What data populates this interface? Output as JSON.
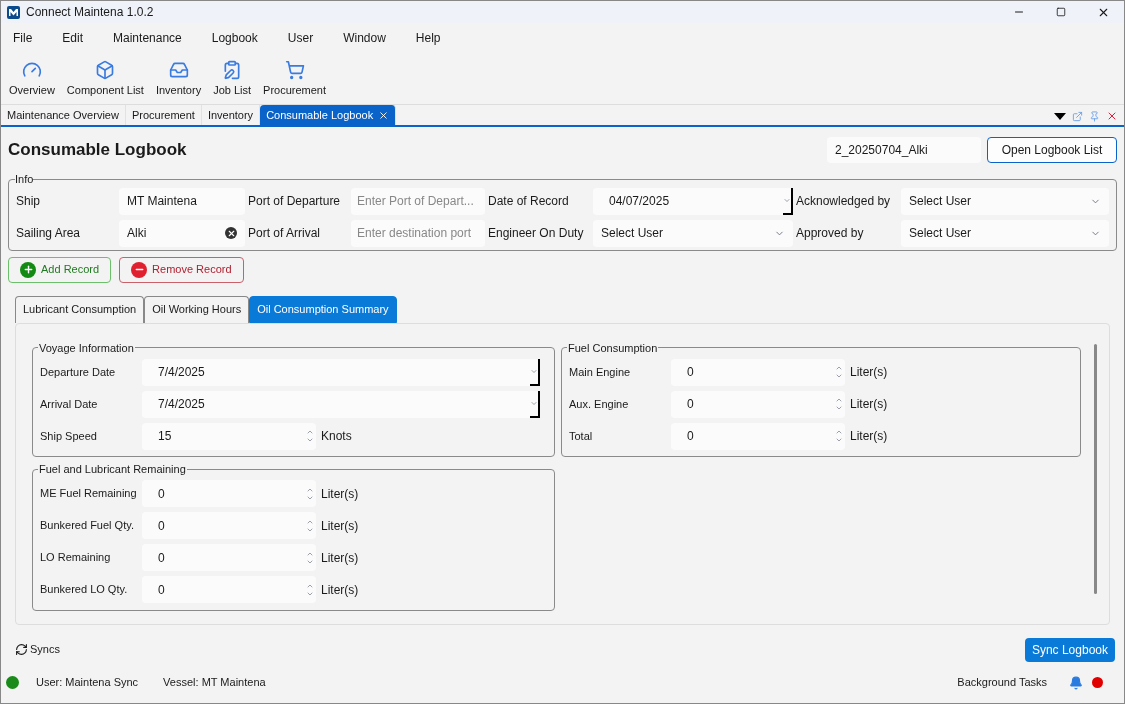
{
  "window": {
    "title": "Connect Maintena 1.0.2"
  },
  "menu": [
    "File",
    "Edit",
    "Maintenance",
    "Logbook",
    "User",
    "Window",
    "Help"
  ],
  "toolbar": [
    "Overview",
    "Component List",
    "Inventory",
    "Job List",
    "Procurement"
  ],
  "doc_tabs": [
    {
      "label": "Maintenance Overview",
      "selected": false,
      "closable": false
    },
    {
      "label": "Procurement",
      "selected": false,
      "closable": false
    },
    {
      "label": "Inventory",
      "selected": false,
      "closable": false
    },
    {
      "label": "Consumable Logbook",
      "selected": true,
      "closable": true
    }
  ],
  "header": {
    "title": "Consumable Logbook",
    "logbook_name": "2_20250704_Alki",
    "open_button": "Open Logbook List"
  },
  "info": {
    "legend": "Info",
    "fields": [
      {
        "label": "Ship",
        "kind": "text",
        "value": "MT Maintena"
      },
      {
        "label": "Port of Departure",
        "kind": "text",
        "placeholder": "Enter Port of Depart..."
      },
      {
        "label": "Date of Record",
        "kind": "date",
        "value": "04/07/2025"
      },
      {
        "label": "Acknowledged by",
        "kind": "select",
        "value": "Select User"
      },
      {
        "label": "Sailing Area",
        "kind": "clearable",
        "value": "Alki"
      },
      {
        "label": "Port of Arrival",
        "kind": "text",
        "placeholder": "Enter destination port"
      },
      {
        "label": "Engineer On Duty",
        "kind": "select",
        "value": "Select User"
      },
      {
        "label": "Approved by",
        "kind": "select",
        "value": "Select User"
      }
    ]
  },
  "actions": [
    {
      "label": "Add Record",
      "kind": "add"
    },
    {
      "label": "Remove Record",
      "kind": "remove"
    }
  ],
  "sub_tabs": [
    {
      "label": "Lubricant Consumption",
      "selected": false
    },
    {
      "label": "Oil Working Hours",
      "selected": false
    },
    {
      "label": "Oil Consumption Summary",
      "selected": true
    }
  ],
  "groups": [
    {
      "legend": "Voyage Information",
      "rows": [
        {
          "label": "Departure Date",
          "kind": "date",
          "value": "7/4/2025"
        },
        {
          "label": "Arrival Date",
          "kind": "date",
          "value": "7/4/2025"
        },
        {
          "label": "Ship Speed",
          "kind": "number",
          "value": "15",
          "unit": "Knots"
        }
      ]
    },
    {
      "legend": "Fuel Consumption",
      "rows": [
        {
          "label": "Main Engine",
          "kind": "number",
          "value": "0",
          "unit": "Liter(s)"
        },
        {
          "label": "Aux. Engine",
          "kind": "number",
          "value": "0",
          "unit": "Liter(s)"
        },
        {
          "label": "Total",
          "kind": "number",
          "value": "0",
          "unit": "Liter(s)"
        }
      ]
    },
    {
      "legend": "Fuel and Lubricant Remaining",
      "rows": [
        {
          "label": "ME Fuel Remaining",
          "kind": "number",
          "value": "0",
          "unit": "Liter(s)"
        },
        {
          "label": "Bunkered Fuel Qty.",
          "kind": "number",
          "value": "0",
          "unit": "Liter(s)"
        },
        {
          "label": "LO Remaining",
          "kind": "number",
          "value": "0",
          "unit": "Liter(s)"
        },
        {
          "label": "Bunkered LO Qty.",
          "kind": "number",
          "value": "0",
          "unit": "Liter(s)"
        }
      ]
    }
  ],
  "footer": {
    "syncs": "Syncs",
    "sync_button": "Sync Logbook"
  },
  "status_bar": {
    "online": true,
    "user": "User: Maintena Sync",
    "vessel": "Vessel: MT Maintena",
    "tasks": "Background Tasks",
    "alert": true
  }
}
